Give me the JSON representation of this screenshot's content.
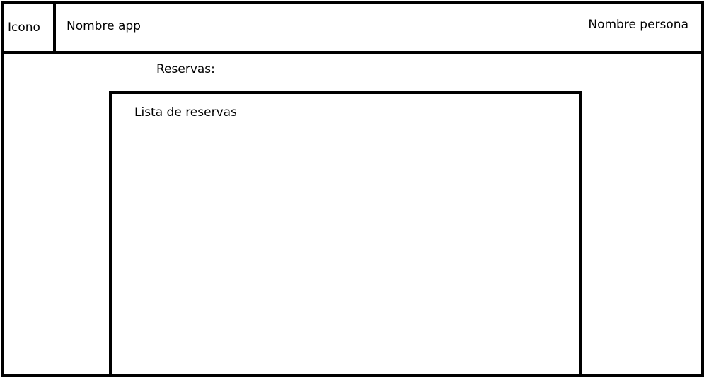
{
  "header": {
    "icon_label": "Icono",
    "app_name": "Nombre app",
    "user_name": "Nombre persona"
  },
  "main": {
    "section_title": "Reservas:",
    "list_label": "Lista de reservas"
  }
}
